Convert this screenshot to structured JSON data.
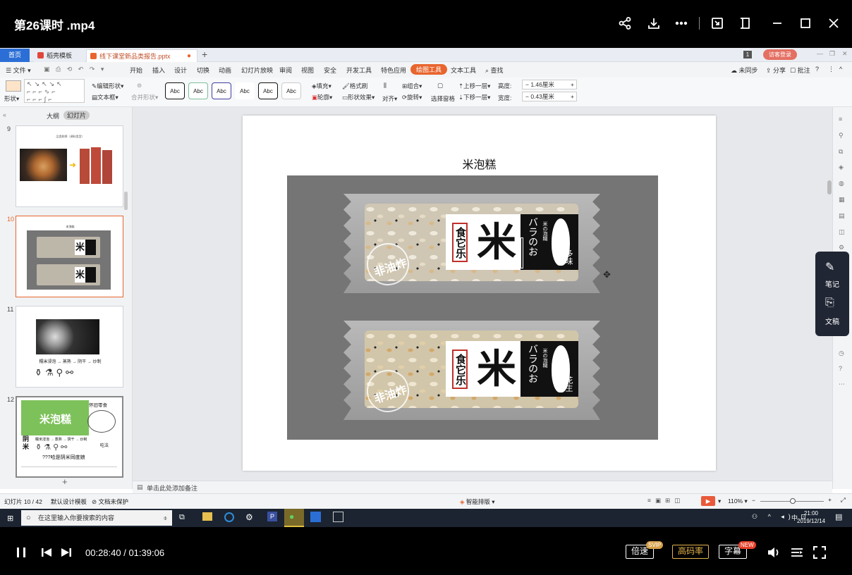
{
  "player": {
    "title": "第26课时 .mp4",
    "current_time": "00:28:40",
    "duration": "01:39:06",
    "time_sep": " / ",
    "speed_label": "倍速",
    "speed_badge": "SVIP",
    "quality_label": "高码率",
    "subtitle_label": "字幕",
    "subtitle_badge": "NEW"
  },
  "tabs": {
    "home": "首页",
    "template": "稻壳模板",
    "doc": "线下课堂新品类报告.pptx"
  },
  "account": {
    "login": "访客登录"
  },
  "menu": [
    "文件",
    "开始",
    "插入",
    "设计",
    "切换",
    "动画",
    "幻灯片放映",
    "审阅",
    "视图",
    "安全",
    "开发工具",
    "特色应用",
    "绘图工具",
    "文本工具",
    "查找"
  ],
  "menu_right": {
    "sync": "未同步",
    "share": "分享",
    "comment": "批注"
  },
  "toolbar": {
    "shape": "形状",
    "edit_shape": "编辑形状",
    "textbox": "文本框",
    "merge_shape": "合并形状",
    "abc": "Abc",
    "fill": "填充",
    "outline": "轮廓",
    "format_painter": "格式刷",
    "shape_effect": "形状效果",
    "align": "对齐",
    "group": "组合",
    "rotate": "旋转",
    "selection_pane": "选择窗格",
    "bring_forward": "上移一层",
    "send_backward": "下移一层",
    "height_label": "高度:",
    "height_value": "1.46厘米",
    "width_label": "宽度:",
    "width_value": "0.43厘米"
  },
  "panel": {
    "outline_tab": "大纲",
    "slides_tab": "幻灯片",
    "slides": [
      {
        "num": "9",
        "caption": "品类联想（调料类型）"
      },
      {
        "num": "10",
        "caption": "米泡糕"
      },
      {
        "num": "11",
        "caption": "糯米浸泡 → 蒸熟 → 阴干 → 炒制"
      },
      {
        "num": "12",
        "title": "米泡糕",
        "left_words": "阴米",
        "brand": "怀旧零食",
        "right_words": "吃法",
        "question": "???哈是阴米同度娘",
        "process": "糯米浸泡 → 蒸熟 → 阴干 → 炒制"
      }
    ]
  },
  "slide": {
    "title": "米泡糕",
    "packages": [
      {
        "brand": "食它乐",
        "big_char": "米",
        "jp_text": "バラのお",
        "sub_text": "米の泡糊",
        "flavor": "多味",
        "stamp": "非油炸"
      },
      {
        "brand": "食它乐",
        "big_char": "米",
        "jp_text": "バラのお",
        "sub_text": "米の泡糊",
        "flavor": "花生",
        "stamp": "非油炸"
      }
    ]
  },
  "notes": {
    "placeholder": "单击此处添加备注"
  },
  "status": {
    "slide_count": "幻灯片 10 / 42",
    "template": "默认设计模板",
    "protect": "文档未保护",
    "smart_layout": "智能排版",
    "zoom": "110%"
  },
  "float_panel": {
    "notes": "笔记",
    "draft": "文稿"
  },
  "taskbar": {
    "search_placeholder": "在这里输入你要搜索的内容",
    "ime": "中",
    "time": "21:00",
    "date": "2019/12/14"
  }
}
